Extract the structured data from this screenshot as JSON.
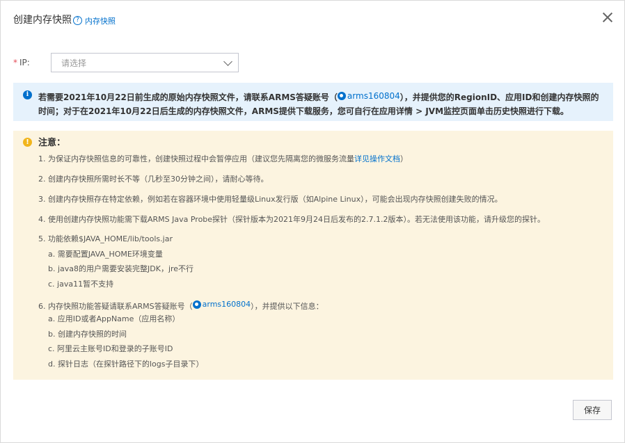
{
  "header": {
    "title": "创建内存快照",
    "help_glyph": "?",
    "help_link": "内存快照"
  },
  "form": {
    "ip_required_mark": "*",
    "ip_label": "IP:",
    "ip_placeholder": "请选择"
  },
  "info": {
    "icon_glyph": "i",
    "text_before": "若需要2021年10月22日前生成的原始内存快照文件，请联系ARMS答疑账号（",
    "account": "arms160804",
    "text_after": "），并提供您的RegionID、应用ID和创建内存快照的时间；对于在2021年10月22日后生成的内存快照文件，ARMS提供下载服务，您可自行在应用详情 > JVM监控页面单击历史快照进行下载。"
  },
  "notice": {
    "icon_glyph": "!",
    "title": "注意：",
    "item1_text": "1. 为保证内存快照信息的可靠性，创建快照过程中会暂停应用（建议您先隔离您的微服务流量",
    "item1_link": "详见操作文档",
    "item1_end": "）",
    "item2": "2. 创建内存快照所需时长不等（几秒至30分钟之间），请耐心等待。",
    "item3": "3. 创建内存快照存在特定依赖，例如若在容器环境中使用轻量级Linux发行版（如Alpine Linux），可能会出现内存快照创建失败的情况。",
    "item4": "4. 使用创建内存快照功能需下载ARMS Java Probe探针（探针版本为2021年9月24日后发布的2.7.1.2版本）。若无法使用该功能，请升级您的探针。",
    "item5": "5. 功能依赖$JAVA_HOME/lib/tools.jar",
    "item5a": "a. 需要配置JAVA_HOME环境变量",
    "item5b": "b. java8的用户需要安装完整JDK，jre不行",
    "item5c": "c. java11暂不支持",
    "item6_before": "6. 内存快照功能答疑请联系ARMS答疑账号（",
    "item6_account": "arms160804",
    "item6_after": "），并提供以下信息：",
    "item6a": "a. 应用ID或者AppName（应用名称）",
    "item6b": "b. 创建内存快照的时间",
    "item6c": "c. 阿里云主账号ID和登录的子账号ID",
    "item6d": "d. 探针日志（在探针路径下的logs子目录下）"
  },
  "footer": {
    "save_label": "保存"
  }
}
